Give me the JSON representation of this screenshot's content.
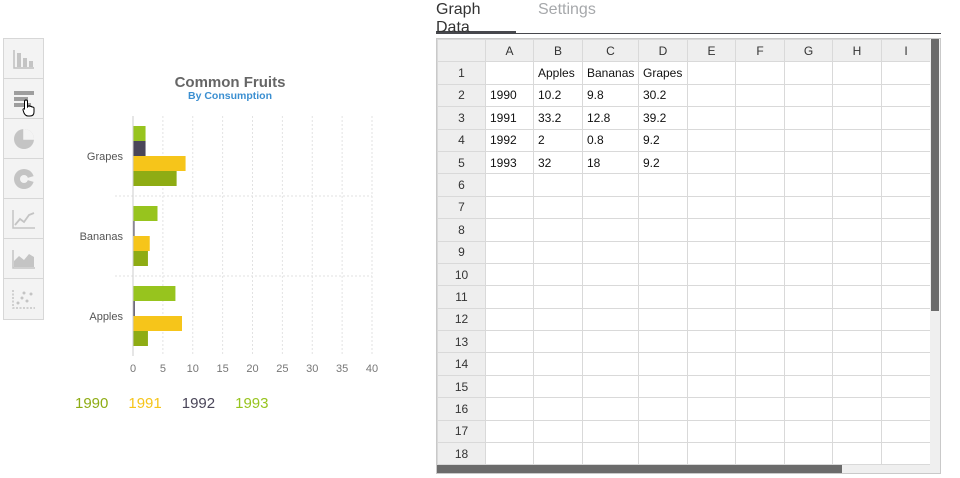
{
  "toolbar": {
    "icons": [
      "bar-chart-icon",
      "horizontal-bar-chart-icon",
      "pie-chart-icon",
      "donut-chart-icon",
      "line-chart-icon",
      "area-chart-icon",
      "scatter-chart-icon"
    ]
  },
  "tabs": {
    "graph_data": "Graph Data",
    "settings": "Settings"
  },
  "colors": {
    "s1990": "#8eac14",
    "s1991": "#f6c51a",
    "s1992": "#4a4659",
    "s1993": "#97c41e",
    "accent": "#3b8fd1"
  },
  "chart_data": {
    "type": "bar",
    "orientation": "horizontal",
    "title": "Common Fruits",
    "subtitle": "By Consumption",
    "categories": [
      "Apples",
      "Bananas",
      "Grapes"
    ],
    "series": [
      {
        "name": "1990",
        "values": [
          2.5,
          2.5,
          7.3
        ]
      },
      {
        "name": "1991",
        "values": [
          8.2,
          2.8,
          8.8
        ]
      },
      {
        "name": "1992",
        "values": [
          0.3,
          0.1,
          2.1
        ]
      },
      {
        "name": "1993",
        "values": [
          7.1,
          4.1,
          2.1
        ]
      }
    ],
    "xlim": [
      0,
      40
    ],
    "xticks": [
      "0",
      "5",
      "10",
      "15",
      "20",
      "25",
      "30",
      "35",
      "40"
    ],
    "grid": true,
    "legend_position": "bottom"
  },
  "sheet": {
    "columns": [
      "A",
      "B",
      "C",
      "D",
      "E",
      "F",
      "G",
      "H",
      "I"
    ],
    "row_numbers": [
      "1",
      "2",
      "3",
      "4",
      "5",
      "6",
      "7",
      "8",
      "9",
      "10",
      "11",
      "12",
      "13",
      "14",
      "15",
      "16",
      "17",
      "18"
    ],
    "cells": [
      [
        "",
        "Apples",
        "Bananas",
        "Grapes",
        "",
        "",
        "",
        "",
        ""
      ],
      [
        "1990",
        "10.2",
        "9.8",
        "30.2",
        "",
        "",
        "",
        "",
        ""
      ],
      [
        "1991",
        "33.2",
        "12.8",
        "39.2",
        "",
        "",
        "",
        "",
        ""
      ],
      [
        "1992",
        "2",
        "0.8",
        "9.2",
        "",
        "",
        "",
        "",
        ""
      ],
      [
        "1993",
        "32",
        "18",
        "9.2",
        "",
        "",
        "",
        "",
        ""
      ]
    ]
  }
}
